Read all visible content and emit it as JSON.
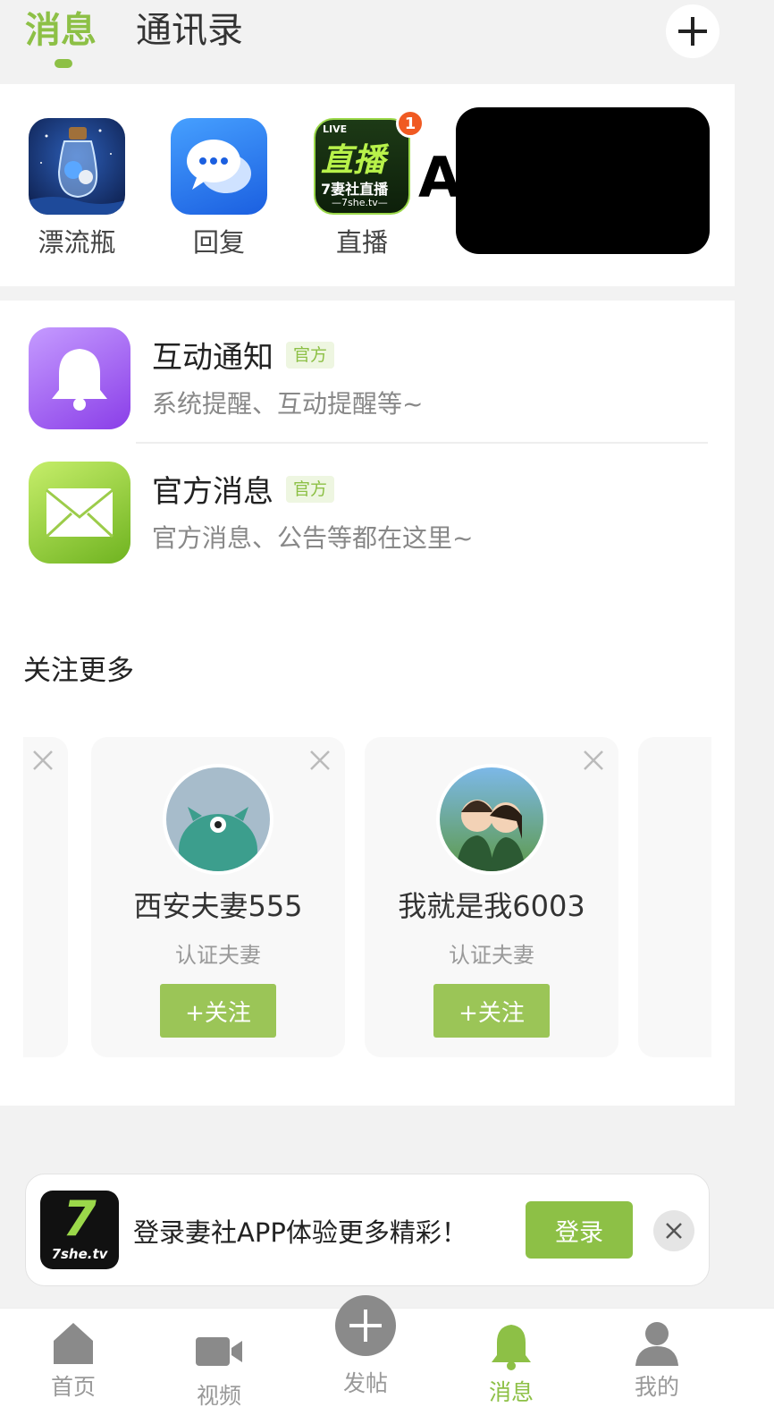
{
  "header": {
    "tabs": [
      {
        "label": "消息",
        "active": true
      },
      {
        "label": "通讯录",
        "active": false
      }
    ]
  },
  "quick_apps": [
    {
      "label": "漂流瓶",
      "icon": "drift-bottle-icon"
    },
    {
      "label": "回复",
      "icon": "chat-bubble-icon"
    },
    {
      "label": "直播",
      "icon": "live-icon",
      "badge": "1",
      "icon_text": "直播",
      "icon_sub": "7妻社直播",
      "icon_live": "LIVE",
      "icon_url": "—7she.tv—"
    }
  ],
  "notifications": [
    {
      "title": "互动通知",
      "tag": "官方",
      "subtitle": "系统提醒、互动提醒等~",
      "icon": "bell-icon"
    },
    {
      "title": "官方消息",
      "tag": "官方",
      "subtitle": "官方消息、公告等都在这里~",
      "icon": "envelope-icon"
    }
  ],
  "follow_more": {
    "title": "关注更多",
    "cards": [
      {
        "name": "西安夫妻555",
        "subtitle": "认证夫妻",
        "button": "+关注"
      },
      {
        "name": "我就是我6003",
        "subtitle": "认证夫妻",
        "button": "+关注"
      }
    ]
  },
  "login_banner": {
    "logo_text": "7",
    "logo_sub": "7she.tv",
    "text": "登录妻社APP体验更多精彩！",
    "button": "登录"
  },
  "bottom_nav": [
    {
      "label": "首页",
      "icon": "home-icon",
      "active": false
    },
    {
      "label": "视频",
      "icon": "video-camera-icon",
      "active": false
    },
    {
      "label": "发帖",
      "icon": "plus-circle-icon",
      "active": false
    },
    {
      "label": "消息",
      "icon": "bell-icon",
      "active": true
    },
    {
      "label": "我的",
      "icon": "person-icon",
      "active": false
    }
  ],
  "colors": {
    "accent": "#8dc046",
    "follow_button": "#9bc557",
    "badge": "#f05a22"
  }
}
